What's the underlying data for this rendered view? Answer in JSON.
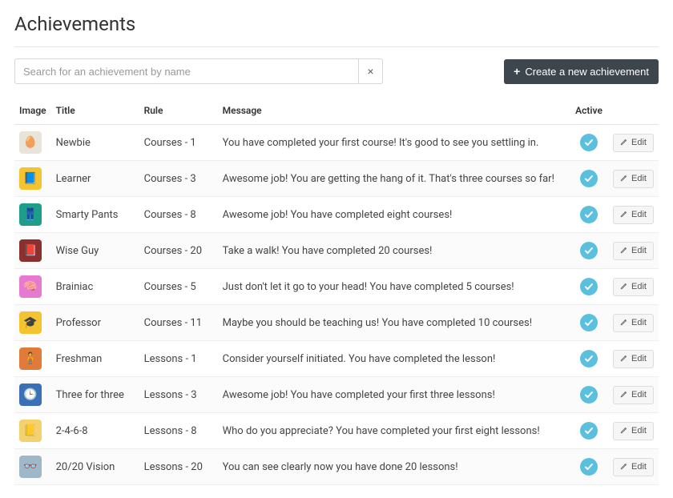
{
  "page": {
    "title": "Achievements"
  },
  "toolbar": {
    "search_placeholder": "Search for an achievement by name",
    "clear_label": "×",
    "create_label": "Create a new achievement"
  },
  "table": {
    "headers": {
      "image": "Image",
      "title": "Title",
      "rule": "Rule",
      "message": "Message",
      "active": "Active"
    },
    "edit_label": "Edit",
    "rows": [
      {
        "title": "Newbie",
        "rule": "Courses - 1",
        "message": "You have completed your first course! It's good to see you settling in.",
        "active": true,
        "badge_bg": "#e9e4da",
        "badge_emoji": "🥚"
      },
      {
        "title": "Learner",
        "rule": "Courses - 3",
        "message": "Awesome job! You are getting the hang of it. That's three courses so far!",
        "active": true,
        "badge_bg": "#f4c430",
        "badge_emoji": "📘"
      },
      {
        "title": "Smarty Pants",
        "rule": "Courses - 8",
        "message": "Awesome job! You have completed eight courses!",
        "active": true,
        "badge_bg": "#1e9e8a",
        "badge_emoji": "👖"
      },
      {
        "title": "Wise Guy",
        "rule": "Courses - 20",
        "message": "Take a walk! You have completed 20 courses!",
        "active": true,
        "badge_bg": "#8b2f2f",
        "badge_emoji": "📕"
      },
      {
        "title": "Brainiac",
        "rule": "Courses - 5",
        "message": "Just don't let it go to your head! You have completed 5 courses!",
        "active": true,
        "badge_bg": "#e67ad1",
        "badge_emoji": "🧠"
      },
      {
        "title": "Professor",
        "rule": "Courses - 11",
        "message": "Maybe you should be teaching us! You have completed 10 courses!",
        "active": true,
        "badge_bg": "#f4c430",
        "badge_emoji": "🎓"
      },
      {
        "title": "Freshman",
        "rule": "Lessons - 1",
        "message": "Consider yourself initiated. You have completed the lesson!",
        "active": true,
        "badge_bg": "#e07b39",
        "badge_emoji": "🧍"
      },
      {
        "title": "Three for three",
        "rule": "Lessons - 3",
        "message": "Awesome job! You have completed your first three lessons!",
        "active": true,
        "badge_bg": "#3b6fb6",
        "badge_emoji": "🕒"
      },
      {
        "title": "2-4-6-8",
        "rule": "Lessons - 8",
        "message": "Who do you appreciate? You have completed your first eight lessons!",
        "active": true,
        "badge_bg": "#f4d06f",
        "badge_emoji": "📒"
      },
      {
        "title": "20/20 Vision",
        "rule": "Lessons - 20",
        "message": "You can see clearly now you have done 20 lessons!",
        "active": true,
        "badge_bg": "#9fb8c9",
        "badge_emoji": "👓"
      }
    ]
  }
}
